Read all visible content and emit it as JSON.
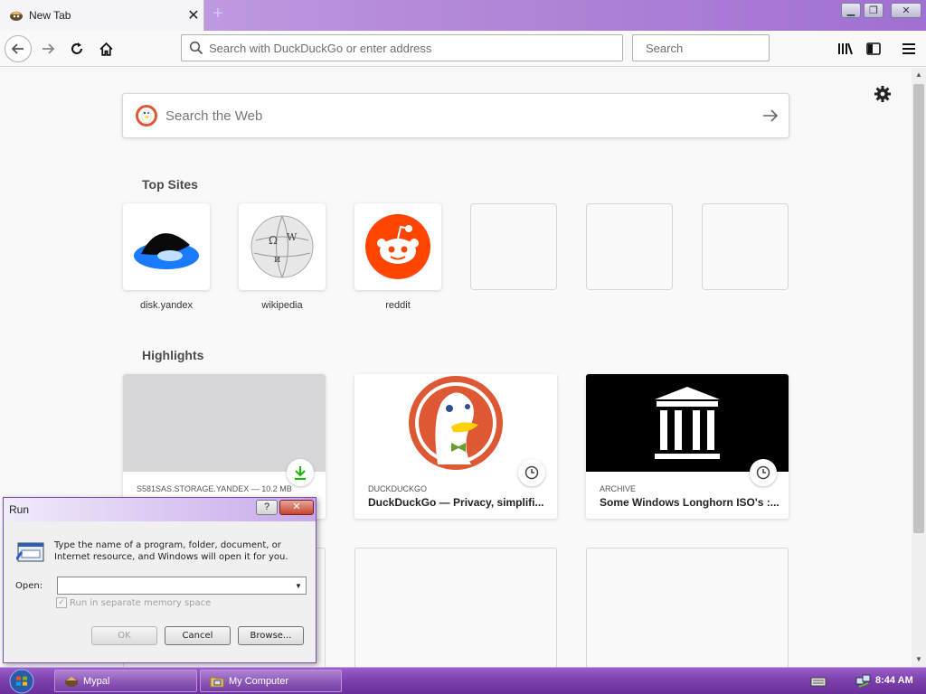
{
  "browser": {
    "tab": {
      "title": "New Tab",
      "close_glyph": "✕"
    },
    "new_tab_glyph": "+",
    "window_controls": {
      "minimize": "▁",
      "restore": "❐",
      "close": "✕"
    },
    "nav": {
      "address_placeholder": "Search with DuckDuckGo or enter address",
      "search_placeholder": "Search"
    }
  },
  "newtab": {
    "web_search_placeholder": "Search the Web",
    "top_sites_title": "Top Sites",
    "top_sites": [
      {
        "label": "disk.yandex",
        "icon": "yandex-disk-icon"
      },
      {
        "label": "wikipedia",
        "icon": "wikipedia-globe-icon"
      },
      {
        "label": "reddit",
        "icon": "reddit-icon"
      }
    ],
    "highlights_title": "Highlights",
    "highlights": [
      {
        "source": "S581SAS.STORAGE.YANDEX — 10.2 MB",
        "title": "",
        "badge": "download-icon"
      },
      {
        "source": "DUCKDUCKGO",
        "title": "DuckDuckGo — Privacy, simplifi...",
        "badge": "clock-icon"
      },
      {
        "source": "ARCHIVE",
        "title": "Some Windows Longhorn ISO's :...",
        "badge": "clock-icon"
      }
    ]
  },
  "run_dialog": {
    "title": "Run",
    "help_label": "?",
    "close_label": "✕",
    "description": "Type the name of a program, folder, document, or Internet resource, and Windows will open it for you.",
    "open_label": "Open:",
    "open_value": "",
    "checkbox_label": "Run in separate memory space",
    "checkbox_glyph": "✓",
    "ok_label": "OK",
    "cancel_label": "Cancel",
    "browse_label": "Browse..."
  },
  "taskbar": {
    "items": [
      {
        "label": "Mypal"
      },
      {
        "label": "My Computer"
      }
    ],
    "clock": "8:44 AM"
  },
  "colors": {
    "accent_purple": "#7b3fac",
    "reddit_orange": "#ff4500",
    "ddg_orange": "#de5833",
    "yandex_blue": "#1a7bff"
  }
}
